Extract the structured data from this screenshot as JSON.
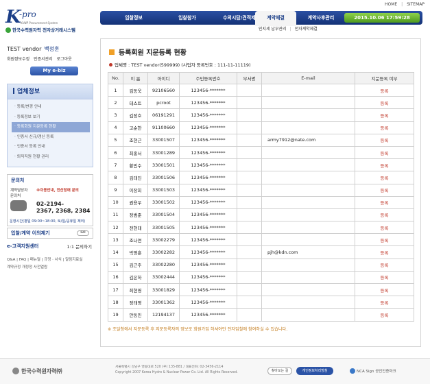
{
  "top_links": {
    "home": "HOME",
    "sitemap": "SITEMAP"
  },
  "logo": {
    "k": "K",
    "pro": "-pro",
    "tagline": "KHNP Procurement System",
    "name": "한국수력원자력 전자상거래시스템"
  },
  "nav": {
    "items": [
      "입찰정보",
      "입찰참가",
      "수의시담/견적제출",
      "계약체결",
      "계약사후관리"
    ],
    "active_index": 3,
    "clock": "2015.10.06   17:59:28"
  },
  "subnav": {
    "items": [
      "인지세 납부관리",
      "전자계약체결"
    ]
  },
  "user": {
    "name": "TEST vendor",
    "person": "백정훈",
    "links": [
      "회원정보수정",
      "인증서관리",
      "로그아웃"
    ],
    "mybiz": "My e-biz"
  },
  "menu": {
    "title": "업체정보",
    "items": [
      "등록/변경 안내",
      "등록정보 보기",
      "등록회원 지문등록 현황",
      "인증서 신규/갱신 등록",
      "인증서 등록 안내",
      "퇴직직원 현황 관리"
    ],
    "active_index": 2
  },
  "contact": {
    "title": "문의처",
    "left_label": "계약담당자 문의처",
    "right_label": "※이용안내, 전산장애 문의",
    "number_line1": "02-2194-",
    "number_line2": "2367, 2368, 2384",
    "hours": "운영시간(평일 09:00~18:00, 토/일/공휴일 제외)"
  },
  "inquiry": {
    "label": "입찰/계약 이의제기",
    "go": "GO"
  },
  "ecenter": {
    "title": "e-고객지원센터",
    "phone": "1:1 문의하기",
    "links_line1": "Q&A | FAQ | 매뉴얼 | 규정 · 서식 | 알림지료실",
    "links_line2": "계약규정 개정정 사전열람"
  },
  "page": {
    "title": "등록회원 지문등록 현황",
    "company_line": "업체명 : TEST vendor(599999) (사업자 등록번호 : 111-11-11119)"
  },
  "table": {
    "headers": [
      "No.",
      "이 름",
      "아이디",
      "주민등록번호",
      "부서명",
      "E-mail",
      "지문등록 여부"
    ],
    "rows": [
      {
        "no": "1",
        "name": "김동욱",
        "id": "92106560",
        "ssn": "123456-*******",
        "dept": "",
        "email": "",
        "status": "등록"
      },
      {
        "no": "2",
        "name": "테스트",
        "id": "pcroot",
        "ssn": "123456-*******",
        "dept": "",
        "email": "",
        "status": "등록"
      },
      {
        "no": "3",
        "name": "김정호",
        "id": "06191291",
        "ssn": "123456-*******",
        "dept": "",
        "email": "",
        "status": "등록"
      },
      {
        "no": "4",
        "name": "고순한",
        "id": "91100660",
        "ssn": "123456-*******",
        "dept": "",
        "email": "",
        "status": "등록"
      },
      {
        "no": "5",
        "name": "조현근",
        "id": "33001507",
        "ssn": "123456-*******",
        "dept": "",
        "email": "army7912@nate.com",
        "status": "등록"
      },
      {
        "no": "6",
        "name": "최홍서",
        "id": "33001289",
        "ssn": "123456-*******",
        "dept": "",
        "email": "",
        "status": "등록"
      },
      {
        "no": "7",
        "name": "황민수",
        "id": "33001501",
        "ssn": "123456-*******",
        "dept": "",
        "email": "",
        "status": "등록"
      },
      {
        "no": "8",
        "name": "김태진",
        "id": "33001506",
        "ssn": "123456-*******",
        "dept": "",
        "email": "",
        "status": "등록"
      },
      {
        "no": "9",
        "name": "이장희",
        "id": "33001503",
        "ssn": "123456-*******",
        "dept": "",
        "email": "",
        "status": "등록"
      },
      {
        "no": "10",
        "name": "권용우",
        "id": "33001502",
        "ssn": "123456-*******",
        "dept": "",
        "email": "",
        "status": "등록"
      },
      {
        "no": "11",
        "name": "정범준",
        "id": "33001504",
        "ssn": "123456-*******",
        "dept": "",
        "email": "",
        "status": "등록"
      },
      {
        "no": "12",
        "name": "전현태",
        "id": "33001505",
        "ssn": "123456-*******",
        "dept": "",
        "email": "",
        "status": "등록"
      },
      {
        "no": "13",
        "name": "조나연",
        "id": "33002279",
        "ssn": "123456-*******",
        "dept": "",
        "email": "",
        "status": "등록"
      },
      {
        "no": "14",
        "name": "박영훈",
        "id": "33002282",
        "ssn": "123456-*******",
        "dept": "",
        "email": "pjh@kdn.com",
        "status": "등록"
      },
      {
        "no": "15",
        "name": "김근주",
        "id": "33002280",
        "ssn": "123456-*******",
        "dept": "",
        "email": "",
        "status": "등록"
      },
      {
        "no": "16",
        "name": "김은하",
        "id": "33002444",
        "ssn": "123456-*******",
        "dept": "",
        "email": "",
        "status": "등록"
      },
      {
        "no": "17",
        "name": "최현영",
        "id": "33001829",
        "ssn": "123456-*******",
        "dept": "",
        "email": "",
        "status": "등록"
      },
      {
        "no": "18",
        "name": "정태영",
        "id": "33001362",
        "ssn": "123456-*******",
        "dept": "",
        "email": "",
        "status": "등록"
      },
      {
        "no": "19",
        "name": "안동민",
        "id": "12194137",
        "ssn": "123456-*******",
        "dept": "",
        "email": "",
        "status": "등록"
      }
    ]
  },
  "note": "※ 조달청에서 지문등록 후 지문등록자의 정보로 회원가입 하셔야만 전자입찰에 참여하실 수 있습니다.",
  "footer": {
    "logo": "한국수력원자력㈜",
    "address": "서울특별시 강남구 영동대로 520 (우) 135-881 / 대표전화: 02-3456-2114",
    "copyright": "Copyright 2007 Korea Hydro & Nuclear Power Co. Ltd. All Rights Reserved.",
    "btn1": "찾아오는 길",
    "btn2": "개인정보처리방침",
    "nca": "NCA Sign 공인인증마크"
  },
  "colors": {
    "brand": "#1c3f88",
    "status_red": "#c0392b",
    "accent_orange": "#f0a028",
    "clock_green": "#6bb832"
  }
}
